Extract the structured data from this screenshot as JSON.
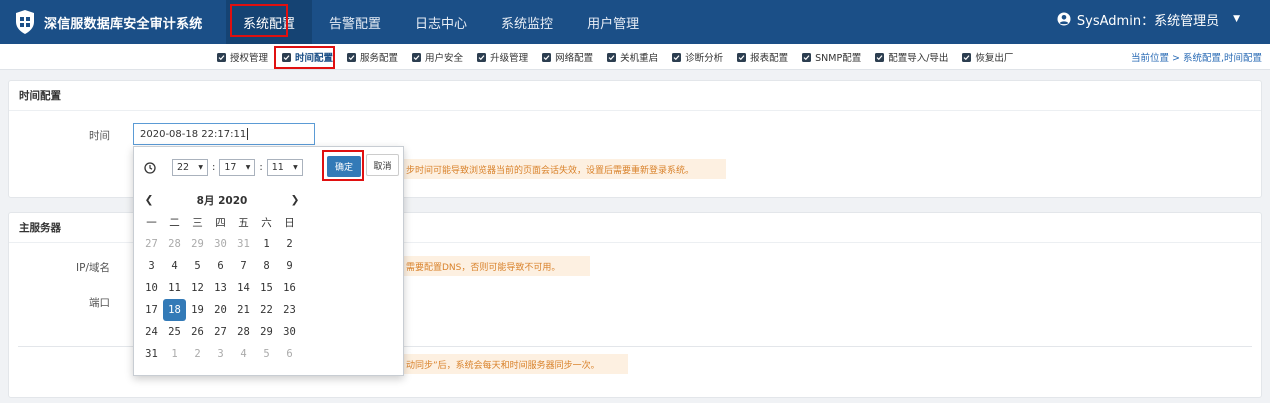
{
  "brand": {
    "name": "深信服数据库安全审计系统"
  },
  "top_menu": [
    {
      "label": "系统配置",
      "active": true
    },
    {
      "label": "告警配置",
      "active": false
    },
    {
      "label": "日志中心",
      "active": false
    },
    {
      "label": "系统监控",
      "active": false
    },
    {
      "label": "用户管理",
      "active": false
    }
  ],
  "user": {
    "label": "SysAdmin：系统管理员"
  },
  "sub_nav": [
    {
      "label": "授权管理",
      "active": false
    },
    {
      "label": "时间配置",
      "active": true
    },
    {
      "label": "服务配置",
      "active": false
    },
    {
      "label": "用户安全",
      "active": false
    },
    {
      "label": "升级管理",
      "active": false
    },
    {
      "label": "网络配置",
      "active": false
    },
    {
      "label": "关机重启",
      "active": false
    },
    {
      "label": "诊断分析",
      "active": false
    },
    {
      "label": "报表配置",
      "active": false
    },
    {
      "label": "SNMP配置",
      "active": false
    },
    {
      "label": "配置导入/导出",
      "active": false
    },
    {
      "label": "恢复出厂",
      "active": false
    }
  ],
  "breadcrumb": "当前位置 > 系统配置,时间配置",
  "time_panel": {
    "title": "时间配置",
    "time_label": "时间",
    "time_value": "2020-08-18 22:17:11",
    "notice": "步时间可能导致浏览器当前的页面会话失效，设置后需要重新登录系统。"
  },
  "server_panel": {
    "title": "主服务器",
    "ip_label": "IP/域名",
    "port_label": "端口",
    "notice_dns": "需要配置DNS，否则可能导致不可用。",
    "notice_sync": "动同步”后，系统会每天和时间服务器同步一次。"
  },
  "picker": {
    "hour": "22",
    "minute": "17",
    "second": "11",
    "ok": "确定",
    "cancel": "取消",
    "month_title": "8月 2020",
    "weekdays": [
      "一",
      "二",
      "三",
      "四",
      "五",
      "六",
      "日"
    ],
    "weeks": [
      [
        [
          "27",
          1
        ],
        [
          "28",
          1
        ],
        [
          "29",
          1
        ],
        [
          "30",
          1
        ],
        [
          "31",
          1
        ],
        [
          "1",
          0
        ],
        [
          "2",
          0
        ]
      ],
      [
        [
          "3",
          0
        ],
        [
          "4",
          0
        ],
        [
          "5",
          0
        ],
        [
          "6",
          0
        ],
        [
          "7",
          0
        ],
        [
          "8",
          0
        ],
        [
          "9",
          0
        ]
      ],
      [
        [
          "10",
          0
        ],
        [
          "11",
          0
        ],
        [
          "12",
          0
        ],
        [
          "13",
          0
        ],
        [
          "14",
          0
        ],
        [
          "15",
          0
        ],
        [
          "16",
          0
        ]
      ],
      [
        [
          "17",
          0
        ],
        [
          "18",
          2
        ],
        [
          "19",
          0
        ],
        [
          "20",
          0
        ],
        [
          "21",
          0
        ],
        [
          "22",
          0
        ],
        [
          "23",
          0
        ]
      ],
      [
        [
          "24",
          0
        ],
        [
          "25",
          0
        ],
        [
          "26",
          0
        ],
        [
          "27",
          0
        ],
        [
          "28",
          0
        ],
        [
          "29",
          0
        ],
        [
          "30",
          0
        ]
      ],
      [
        [
          "31",
          0
        ],
        [
          "1",
          1
        ],
        [
          "2",
          1
        ],
        [
          "3",
          1
        ],
        [
          "4",
          1
        ],
        [
          "5",
          1
        ],
        [
          "6",
          1
        ]
      ]
    ]
  }
}
